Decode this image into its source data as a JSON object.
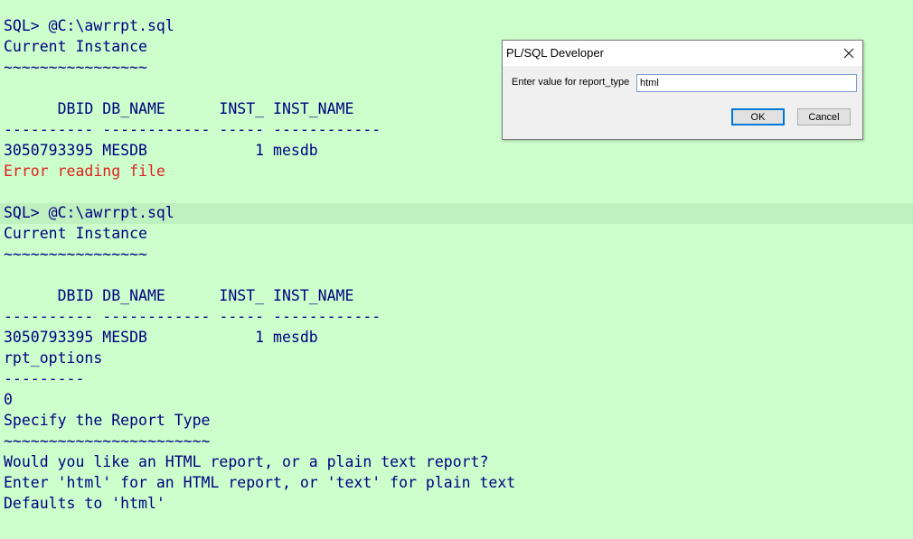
{
  "console": {
    "lines": [
      {
        "text": "SQL> @C:\\awrrpt.sql"
      },
      {
        "text": "Current Instance"
      },
      {
        "text": "~~~~~~~~~~~~~~~~"
      },
      {
        "text": ""
      },
      {
        "text": "      DBID DB_NAME      INST_ INST_NAME"
      },
      {
        "text": "---------- ------------ ----- ------------"
      },
      {
        "text": "3050793395 MESDB            1 mesdb"
      },
      {
        "text": "Error reading file"
      },
      {
        "text": ""
      },
      {
        "text": "SQL> @C:\\awrrpt.sql"
      },
      {
        "text": "Current Instance"
      },
      {
        "text": "~~~~~~~~~~~~~~~~"
      },
      {
        "text": ""
      },
      {
        "text": "      DBID DB_NAME      INST_ INST_NAME"
      },
      {
        "text": "---------- ------------ ----- ------------"
      },
      {
        "text": "3050793395 MESDB            1 mesdb"
      },
      {
        "text": "rpt_options"
      },
      {
        "text": "---------"
      },
      {
        "text": "0"
      },
      {
        "text": "Specify the Report Type"
      },
      {
        "text": "~~~~~~~~~~~~~~~~~~~~~~~"
      },
      {
        "text": "Would you like an HTML report, or a plain text report?"
      },
      {
        "text": "Enter 'html' for an HTML report, or 'text' for plain text"
      },
      {
        "text": "Defaults to 'html'"
      }
    ]
  },
  "colors": {
    "background": "#ccffcc",
    "text": "#000080",
    "error": "#e02020"
  },
  "dialog": {
    "title": "PL/SQL Developer",
    "close_icon": "close-icon",
    "prompt_label": "Enter value for report_type",
    "input_value": "html",
    "ok_label": "OK",
    "cancel_label": "Cancel"
  }
}
